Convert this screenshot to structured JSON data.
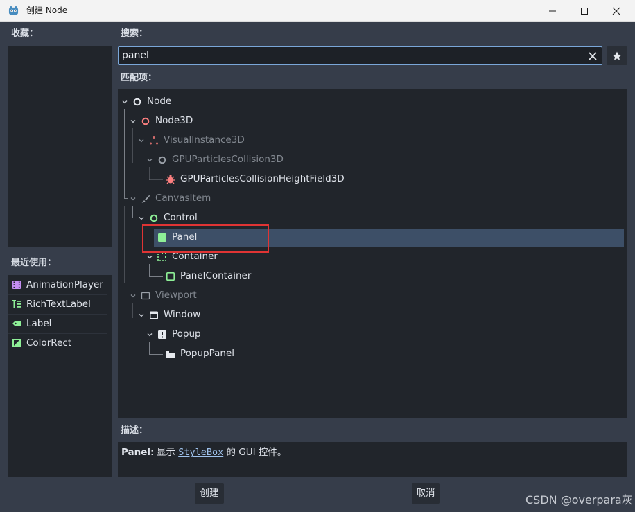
{
  "window": {
    "title": "创建 Node"
  },
  "favorites": {
    "label": "收藏："
  },
  "recent": {
    "label": "最近使用：",
    "items": [
      {
        "label": "AnimationPlayer",
        "icon": "animation-player-icon"
      },
      {
        "label": "RichTextLabel",
        "icon": "rich-text-label-icon"
      },
      {
        "label": "Label",
        "icon": "label-icon"
      },
      {
        "label": "ColorRect",
        "icon": "color-rect-icon"
      }
    ]
  },
  "search": {
    "label": "搜索：",
    "value": "panel"
  },
  "matches": {
    "label": "匹配项：",
    "items": [
      {
        "label": "Node",
        "icon": "node-icon"
      },
      {
        "label": "Node3D",
        "icon": "node3d-icon"
      },
      {
        "label": "VisualInstance3D",
        "icon": "visual-instance3d-icon"
      },
      {
        "label": "GPUParticlesCollision3D",
        "icon": "gpu-particles-collision3d-icon"
      },
      {
        "label": "GPUParticlesCollisionHeightField3D",
        "icon": "gpu-particles-collision-heightfield3d-icon"
      },
      {
        "label": "CanvasItem",
        "icon": "canvas-item-icon"
      },
      {
        "label": "Control",
        "icon": "control-icon"
      },
      {
        "label": "Panel",
        "icon": "panel-icon",
        "selected": true
      },
      {
        "label": "Container",
        "icon": "container-icon"
      },
      {
        "label": "PanelContainer",
        "icon": "panel-container-icon"
      },
      {
        "label": "Viewport",
        "icon": "viewport-icon"
      },
      {
        "label": "Window",
        "icon": "window-icon"
      },
      {
        "label": "Popup",
        "icon": "popup-icon"
      },
      {
        "label": "PopupPanel",
        "icon": "popup-panel-icon"
      }
    ]
  },
  "description": {
    "label": "描述：",
    "name": "Panel",
    "prefix": ": 显示 ",
    "link": "StyleBox",
    "suffix": " 的 GUI 控件。"
  },
  "buttons": {
    "create": "创建",
    "cancel": "取消"
  },
  "watermark": "CSDN @overpara灰",
  "colors": {
    "background": "#363d4a",
    "panel": "#21252b",
    "selection": "#3d4f67",
    "accent": "#7aa7d9",
    "highlight_box": "#e03434"
  }
}
